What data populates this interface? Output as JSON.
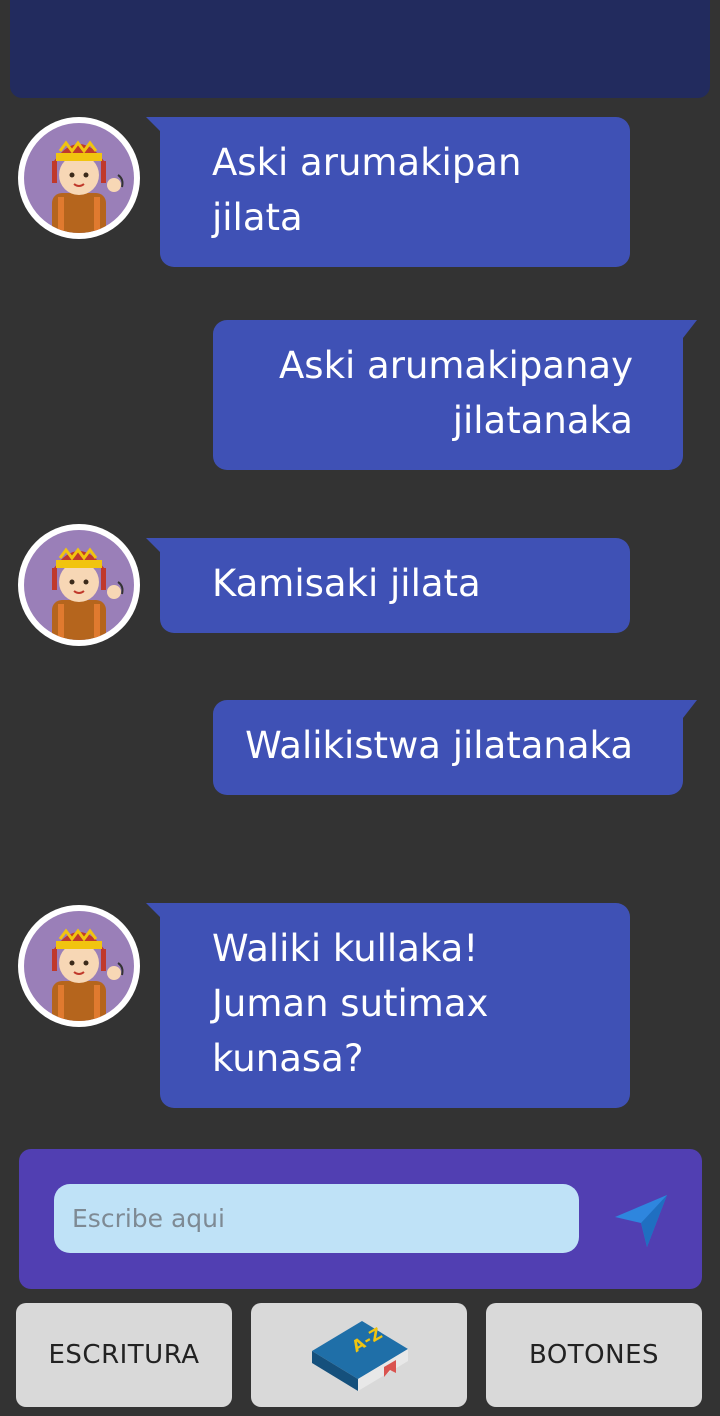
{
  "colors": {
    "background": "#333333",
    "header": "#222b5e",
    "bubble": "#3f51b5",
    "composer": "#513fb2",
    "input": "#bfe2f7",
    "send": "#2e86de",
    "button": "#d9d9d9"
  },
  "messages": [
    {
      "side": "left",
      "text": "Aski arumakipan jilata",
      "avatar": "andean-girl-waving-icon"
    },
    {
      "side": "right",
      "text": "Aski arumakipanay jilatanaka"
    },
    {
      "side": "left",
      "text": "Kamisaki jilata",
      "avatar": "andean-girl-waving-icon"
    },
    {
      "side": "right",
      "text": "Walikistwa jilatanaka"
    },
    {
      "side": "left",
      "text": "Waliki kullaka! Juman sutimax kunasa?",
      "avatar": "andean-girl-waving-icon"
    }
  ],
  "composer": {
    "placeholder": "Escribe aqui",
    "send_icon": "send-icon"
  },
  "bottom_bar": {
    "left_label": "ESCRITURA",
    "center_icon": "dictionary-book-icon",
    "center_icon_text": "A-Z",
    "right_label": "BOTONES"
  }
}
